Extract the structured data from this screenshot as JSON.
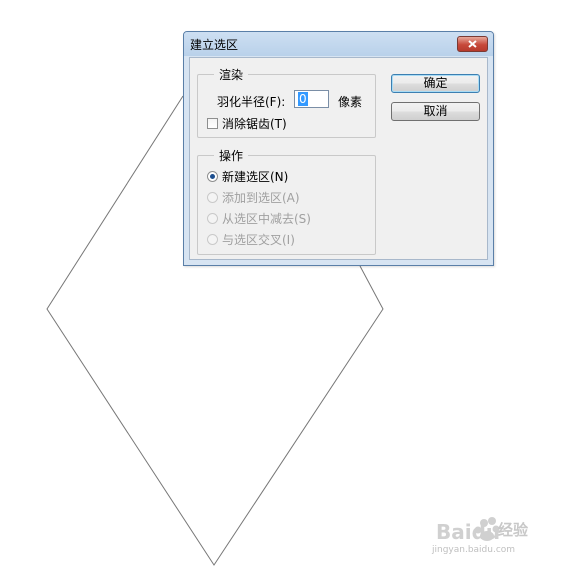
{
  "dialog": {
    "title": "建立选区",
    "ok_label": "确定",
    "cancel_label": "取消"
  },
  "render_group": {
    "legend": "渲染",
    "feather_label": "羽化半径(F):",
    "feather_value": "0",
    "unit": "像素",
    "antialias_label": "消除锯齿(T)",
    "antialias_checked": false
  },
  "operation_group": {
    "legend": "操作",
    "options": [
      {
        "label": "新建选区(N)",
        "selected": true,
        "enabled": true
      },
      {
        "label": "添加到选区(A)",
        "selected": false,
        "enabled": false
      },
      {
        "label": "从选区中减去(S)",
        "selected": false,
        "enabled": false
      },
      {
        "label": "与选区交叉(I)",
        "selected": false,
        "enabled": false
      }
    ]
  },
  "watermark": {
    "brand": "Baidu",
    "text": "经验",
    "url": "jingyan.baidu.com"
  }
}
